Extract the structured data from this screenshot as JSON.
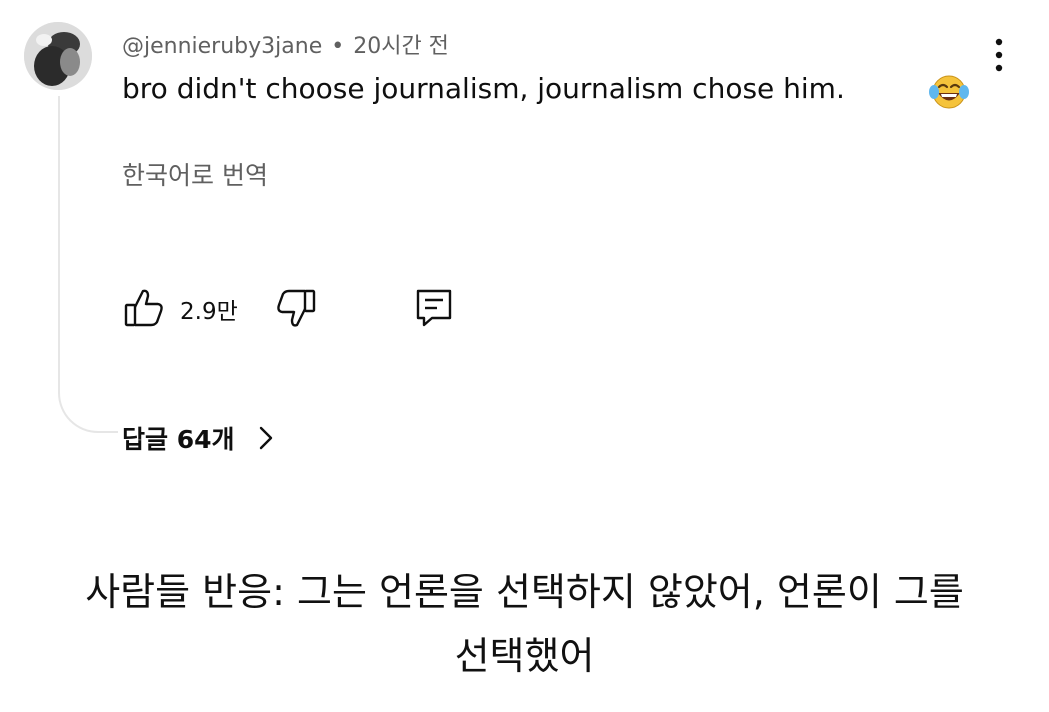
{
  "comment": {
    "author": "@jennieruby3jane",
    "separator": "•",
    "time": "20시간 전",
    "text": "bro didn't choose journalism, journalism chose him.",
    "emoji": "face-with-tears-of-joy",
    "translate_label": "한국어로 번역"
  },
  "actions": {
    "like_count": "2.9만",
    "like_icon": "thumbs-up-icon",
    "dislike_icon": "thumbs-down-icon",
    "reply_icon": "comment-reply-icon",
    "menu_icon": "more-vertical-icon"
  },
  "replies": {
    "label": "답글 64개"
  },
  "caption": {
    "line1": "사람들 반응: 그는 언론을 선택하지 않았어, 언론이 그를",
    "line2": "선택했어"
  }
}
